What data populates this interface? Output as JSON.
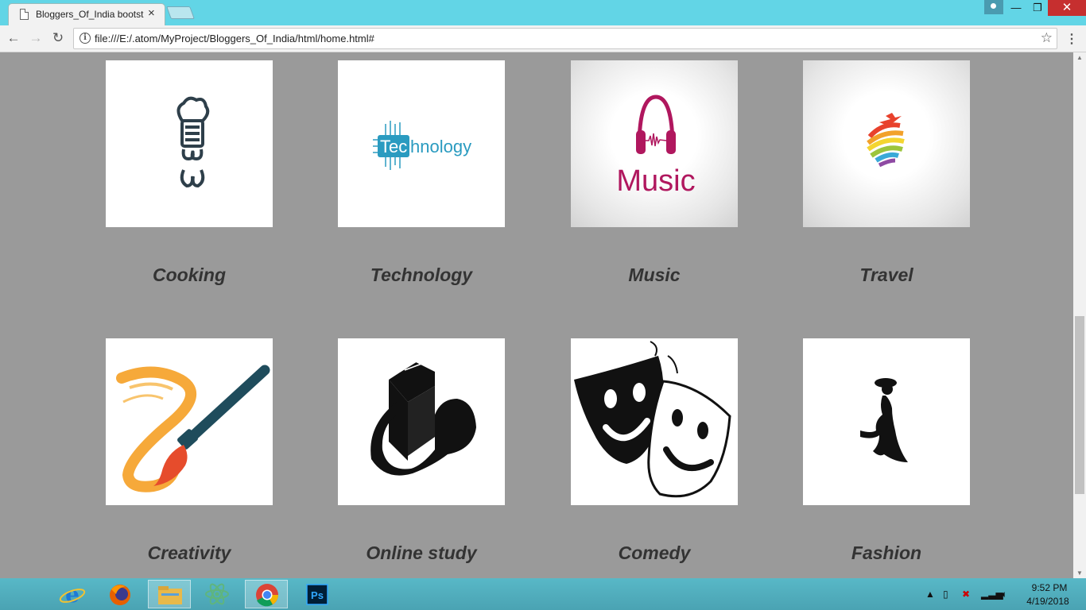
{
  "browser": {
    "tab_title": "Bloggers_Of_India bootst",
    "tab_close": "×",
    "url": "file:///E:/.atom/MyProject/Bloggers_Of_India/html/home.html#",
    "back": "←",
    "forward": "→",
    "reload": "↻",
    "info": "i",
    "star": "☆",
    "menu": "⋮",
    "minimize": "—",
    "maximize": "❐",
    "close": "✕"
  },
  "categories": [
    {
      "label": "Cooking",
      "icon": "chef-hat-icon"
    },
    {
      "label": "Technology",
      "icon": "technology-logo-icon",
      "logo_text": "Technology"
    },
    {
      "label": "Music",
      "icon": "headphones-music-icon",
      "logo_text": "Music"
    },
    {
      "label": "Travel",
      "icon": "globe-plane-icon"
    },
    {
      "label": "Creativity",
      "icon": "paintbrush-icon"
    },
    {
      "label": "Online study",
      "icon": "book-icon"
    },
    {
      "label": "Comedy",
      "icon": "theater-masks-icon"
    },
    {
      "label": "Fashion",
      "icon": "fashion-woman-icon"
    }
  ],
  "taskbar": {
    "apps": [
      "internet-explorer-icon",
      "firefox-icon",
      "file-explorer-icon",
      "atom-icon",
      "chrome-icon",
      "photoshop-icon"
    ],
    "photoshop_label": "Ps",
    "time": "9:52 PM",
    "date": "4/19/2018"
  },
  "colors": {
    "titlebar": "#62d5e6",
    "page_background": "#9a9a9a",
    "label_text": "#333333",
    "music_accent": "#b0175e",
    "tech_accent": "#2a9bc0"
  }
}
